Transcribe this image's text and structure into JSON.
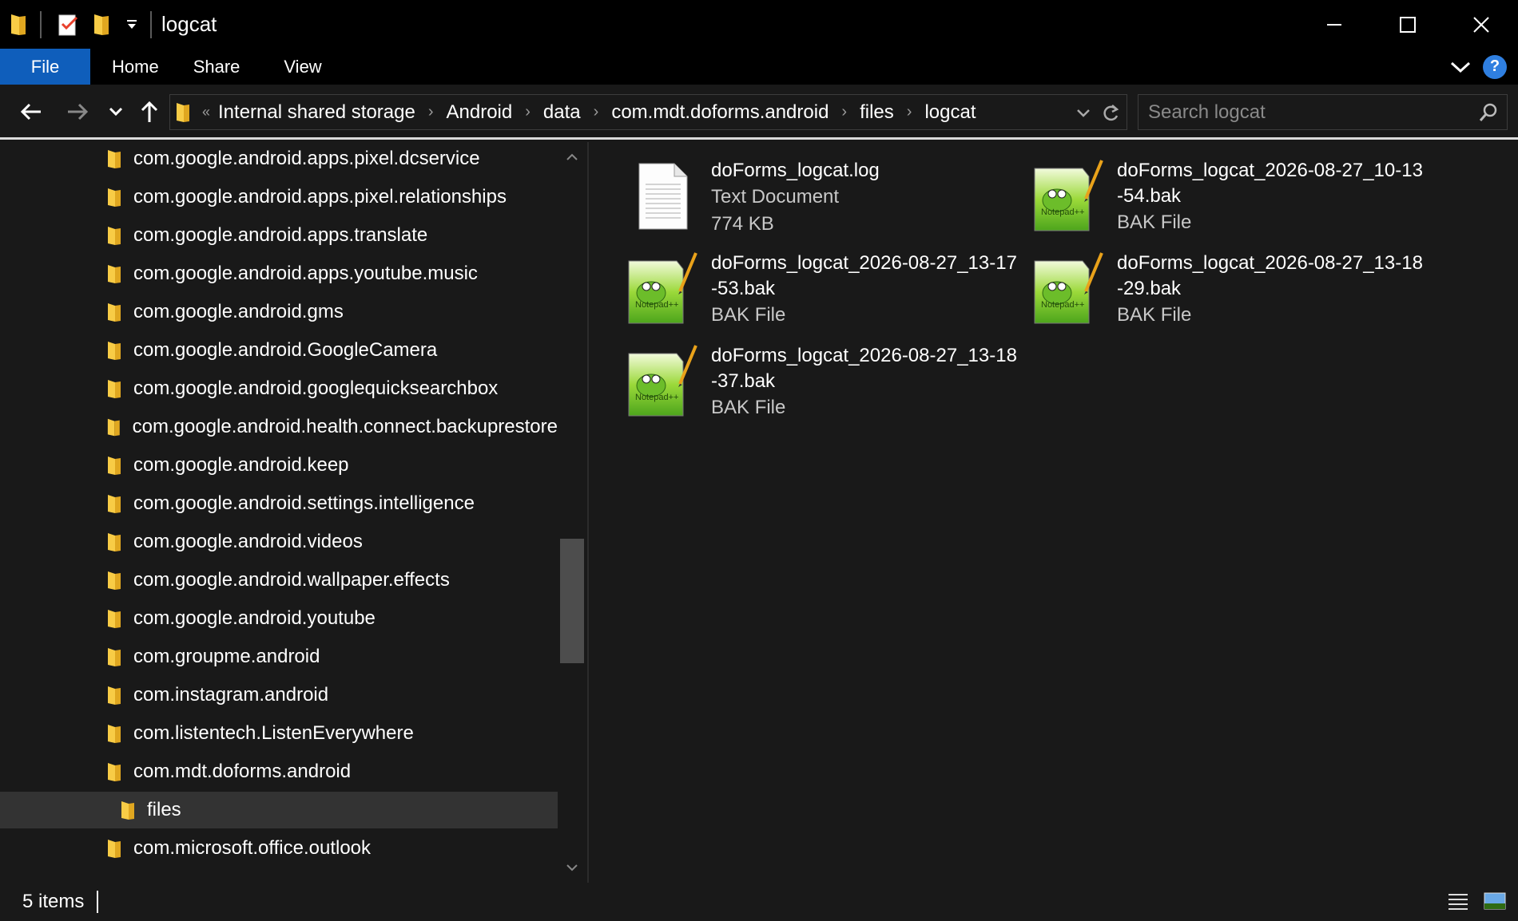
{
  "window": {
    "title": "logcat"
  },
  "ribbon": {
    "tabs": [
      "File",
      "Home",
      "Share",
      "View"
    ],
    "help_label": "?"
  },
  "address": {
    "overflow": "«",
    "crumbs": [
      "Internal shared storage",
      "Android",
      "data",
      "com.mdt.doforms.android",
      "files",
      "logcat"
    ]
  },
  "search": {
    "placeholder": "Search logcat"
  },
  "nav": {
    "items": [
      "com.google.android.apps.pixel.dcservice",
      "com.google.android.apps.pixel.relationships",
      "com.google.android.apps.translate",
      "com.google.android.apps.youtube.music",
      "com.google.android.gms",
      "com.google.android.GoogleCamera",
      "com.google.android.googlequicksearchbox",
      "com.google.android.health.connect.backuprestore",
      "com.google.android.keep",
      "com.google.android.settings.intelligence",
      "com.google.android.videos",
      "com.google.android.wallpaper.effects",
      "com.google.android.youtube",
      "com.groupme.android",
      "com.instagram.android",
      "com.listentech.ListenEverywhere",
      "com.mdt.doforms.android",
      "files",
      "com.microsoft.office.outlook"
    ],
    "selected_item": "files"
  },
  "files": [
    {
      "name": "doForms_logcat.log",
      "type": "Text Document",
      "size": "774 KB",
      "icon": "text-document-icon"
    },
    {
      "name": "doForms_logcat_2026-08-27_10-13\n-54.bak",
      "type": "BAK File",
      "icon": "notepadpp-file-icon"
    },
    {
      "name": "doForms_logcat_2026-08-27_13-17\n-53.bak",
      "type": "BAK File",
      "icon": "notepadpp-file-icon"
    },
    {
      "name": "doForms_logcat_2026-08-27_13-18\n-29.bak",
      "type": "BAK File",
      "icon": "notepadpp-file-icon"
    },
    {
      "name": "doForms_logcat_2026-08-27_13-18\n-37.bak",
      "type": "BAK File",
      "icon": "notepadpp-file-icon"
    }
  ],
  "status": {
    "count": "5 items"
  }
}
